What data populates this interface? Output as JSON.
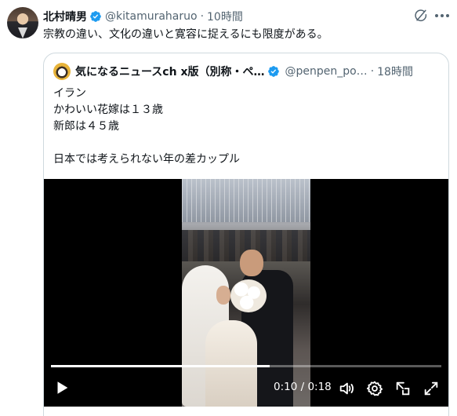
{
  "post": {
    "author_name": "北村晴男",
    "handle": "@kitamuraharuo",
    "separator": "·",
    "time": "10時間",
    "text": "宗教の違い、文化の違いと寛容に捉えるにも限度がある。"
  },
  "quoted": {
    "author_name": "気になるニュースch x版（別称・ペ…",
    "handle": "@penpen_po…",
    "separator": "·",
    "time": "18時間",
    "text": "イラン\nかわいい花嫁は１３歳\n新郎は４５歳\n\n日本では考えられない年の差カップル",
    "video": {
      "current_time": "0:10",
      "duration": "0:18",
      "timecode": "0:10 / 0:18",
      "progress": 0.56
    }
  },
  "icons": {
    "verified": "verified-badge-icon",
    "grok": "grok-icon",
    "more": "more-icon",
    "play": "play-icon",
    "volume": "volume-icon",
    "settings": "settings-icon",
    "pip": "picture-in-picture-icon",
    "fullscreen": "fullscreen-icon"
  },
  "colors": {
    "verified_blue": "#1d9bf0",
    "secondary_text": "#536471",
    "border": "#cfd9de"
  }
}
